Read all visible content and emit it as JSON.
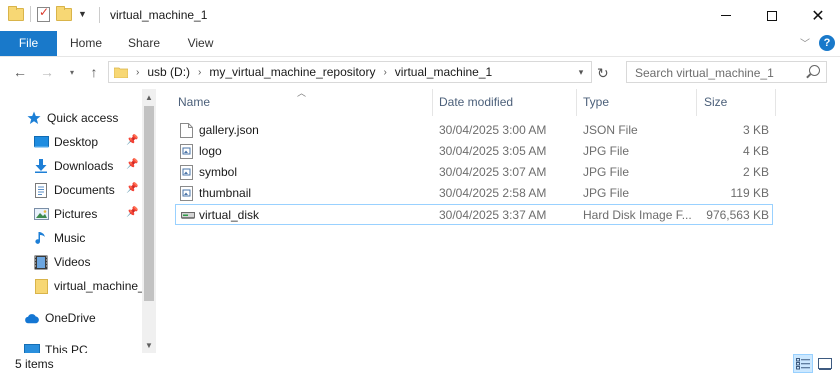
{
  "window": {
    "title": "virtual_machine_1",
    "minimize_icon": "minimize-icon",
    "maximize_icon": "maximize-icon",
    "close_icon": "close-icon"
  },
  "ribbon": {
    "tabs": [
      {
        "label": "File",
        "active": true
      },
      {
        "label": "Home"
      },
      {
        "label": "Share"
      },
      {
        "label": "View"
      }
    ],
    "accent_color": "#1979ca",
    "help_label": "?"
  },
  "address": {
    "breadcrumbs": [
      "usb (D:)",
      "my_virtual_machine_repository",
      "virtual_machine_1"
    ],
    "search_placeholder": "Search virtual_machine_1"
  },
  "nav_pane": {
    "items": [
      {
        "label": "Quick access",
        "icon": "star-icon"
      },
      {
        "label": "Desktop",
        "icon": "desktop-icon",
        "pinned": true
      },
      {
        "label": "Downloads",
        "icon": "download-icon",
        "pinned": true
      },
      {
        "label": "Documents",
        "icon": "documents-icon",
        "pinned": true
      },
      {
        "label": "Pictures",
        "icon": "pictures-icon",
        "pinned": true
      },
      {
        "label": "Music",
        "icon": "music-icon"
      },
      {
        "label": "Videos",
        "icon": "videos-icon"
      },
      {
        "label": "virtual_machine_",
        "icon": "folder-icon"
      },
      {
        "label": "OneDrive",
        "icon": "cloud-icon"
      },
      {
        "label": "This PC",
        "icon": "computer-icon"
      }
    ]
  },
  "file_list": {
    "columns": [
      "Name",
      "Date modified",
      "Type",
      "Size"
    ],
    "rows": [
      {
        "name": "gallery.json",
        "date": "30/04/2025 3:00 AM",
        "type": "JSON File",
        "size": "3 KB",
        "icon": "document-icon"
      },
      {
        "name": "logo",
        "date": "30/04/2025 3:05 AM",
        "type": "JPG File",
        "size": "4 KB",
        "icon": "image-file-icon"
      },
      {
        "name": "symbol",
        "date": "30/04/2025 3:07 AM",
        "type": "JPG File",
        "size": "2 KB",
        "icon": "image-file-icon"
      },
      {
        "name": "thumbnail",
        "date": "30/04/2025 2:58 AM",
        "type": "JPG File",
        "size": "119 KB",
        "icon": "image-file-icon"
      },
      {
        "name": "virtual_disk",
        "date": "30/04/2025 3:37 AM",
        "type": "Hard Disk Image F...",
        "size": "976,563 KB",
        "icon": "disk-image-icon",
        "selected": true
      }
    ]
  },
  "status": {
    "item_count": "5 items"
  }
}
